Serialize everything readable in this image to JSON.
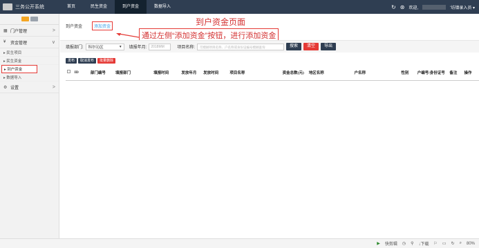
{
  "app": {
    "title": "三务公开系统"
  },
  "nav": {
    "items": [
      "首页",
      "民生资金",
      "到户资金",
      "数据导入"
    ],
    "active_index": 2
  },
  "user": {
    "greeting": "欢迎,",
    "role": "'坊镇录入员 ▾"
  },
  "sidebar": {
    "groups": [
      {
        "label": "门户管理",
        "icon": "grid-icon",
        "arrow": ">"
      },
      {
        "label": "资金管理",
        "icon": "yen-icon",
        "arrow": "∨"
      }
    ],
    "sub_items": [
      "▸ 民生项目",
      "▸ 民生资金",
      "▸ 到户资金",
      "▸ 数据导入"
    ],
    "active_sub_index": 2,
    "settings": {
      "label": "设置",
      "icon": "gears-icon",
      "arrow": ">"
    }
  },
  "tabs": [
    "到户资金",
    "添加资金"
  ],
  "annotation": {
    "title": "到户资金页面",
    "instruction": "通过左侧“添加资金”按钮，进行添加资金",
    "color": "#d32f2f"
  },
  "filters": {
    "dept_label": "填报部门:",
    "dept_value": "科尔沁区",
    "year_label": "填报年月:",
    "year_placeholder": "2018MM",
    "project_label": "项目名称:",
    "project_placeholder": "可模糊项目名称、户名称或身份证编号模糊查询",
    "search": "搜索",
    "clear": "清空",
    "export": "导出"
  },
  "actions": {
    "publish": "发布",
    "unpublish": "取消发布",
    "batch_delete": "批量删除"
  },
  "table": {
    "headers": [
      "ID",
      "部门编号",
      "填报部门",
      "填报时间",
      "发放年月",
      "发放时间",
      "项目名称",
      "资金总数(元)",
      "地区名称",
      "户名称",
      "性别",
      "户编号/身份证号",
      "备注",
      "操作"
    ]
  },
  "statusbar": {
    "items": [
      "快剪辑",
      "↓下载",
      "80%"
    ]
  },
  "colors": {
    "topbar": "#2f3e52",
    "nav_active": "#14222f",
    "accent_red": "#e53935",
    "link_blue": "#3aa0e8"
  }
}
